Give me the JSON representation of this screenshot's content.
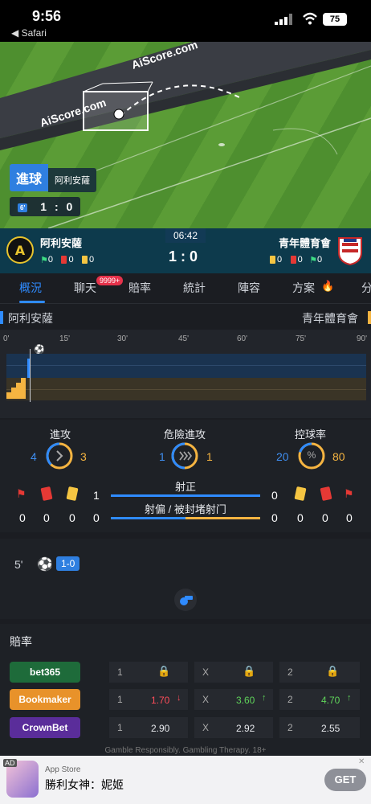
{
  "status_bar": {
    "time": "9:56",
    "back_label": "◀ Safari",
    "battery": "75"
  },
  "field": {
    "watermark_1": "AiScore.com",
    "watermark_2": "AiScore.com",
    "goal_label": "進球",
    "goal_team": "阿利安薩",
    "minute": "6'",
    "mini_home": "1",
    "mini_sep": ":",
    "mini_away": "0"
  },
  "scoreboard": {
    "clock": "06:42",
    "home_name": "阿利安薩",
    "away_name": "青年體育會",
    "score": "1 : 0",
    "home_stats": [
      "0",
      "0",
      "0"
    ],
    "away_stats": [
      "0",
      "0",
      "0"
    ]
  },
  "tabs": {
    "items": [
      "概況",
      "聊天",
      "賠率",
      "統計",
      "陣容",
      "方案",
      "分"
    ],
    "badge": "9999+"
  },
  "teams_row": {
    "home": "阿利安薩",
    "away": "青年體育會"
  },
  "timeline": {
    "ticks": [
      "0'",
      "15'",
      "30'",
      "45'",
      "60'",
      "75'",
      "90'"
    ]
  },
  "stats": {
    "attack_label": "進攻",
    "attack_home": "4",
    "attack_away": "3",
    "danger_label": "危險進攻",
    "danger_home": "1",
    "danger_away": "1",
    "possession_label": "控球率",
    "possession_home": "20",
    "possession_away": "80",
    "possession_icon": "%",
    "shots_on_label": "射正",
    "shots_on_home": "1",
    "shots_on_away": "0",
    "shots_off_label": "射偏 / 被封堵射门",
    "shots_off_home": "0",
    "shots_off_away": "0",
    "home_cards": [
      "0",
      "0",
      "0"
    ],
    "away_cards": [
      "0",
      "0",
      "0"
    ]
  },
  "events": {
    "minute": "5'",
    "score": "1-0"
  },
  "odds": {
    "title": "賠率",
    "rows": [
      {
        "book": "bet365",
        "c1": "1",
        "cx": "X",
        "c2": "2",
        "v1": "",
        "vx": "",
        "v2": ""
      },
      {
        "book": "Bookmaker",
        "c1": "1",
        "cx": "X",
        "c2": "2",
        "v1": "1.70",
        "vx": "3.60",
        "v2": "4.70"
      },
      {
        "book": "CrownBet",
        "c1": "1",
        "cx": "X",
        "c2": "2",
        "v1": "2.90",
        "vx": "2.92",
        "v2": "2.55"
      }
    ],
    "disclaimer": "Gamble Responsibly. Gambling Therapy. 18+"
  },
  "ad": {
    "ad_tag": "AD",
    "store": "App Store",
    "title": "勝利女神：妮姬",
    "cta": "GET"
  },
  "colors": {
    "accent": "#2f8bff",
    "away": "#f5b441",
    "red_down": "#ff4d5a",
    "green_up": "#5fd35a"
  }
}
